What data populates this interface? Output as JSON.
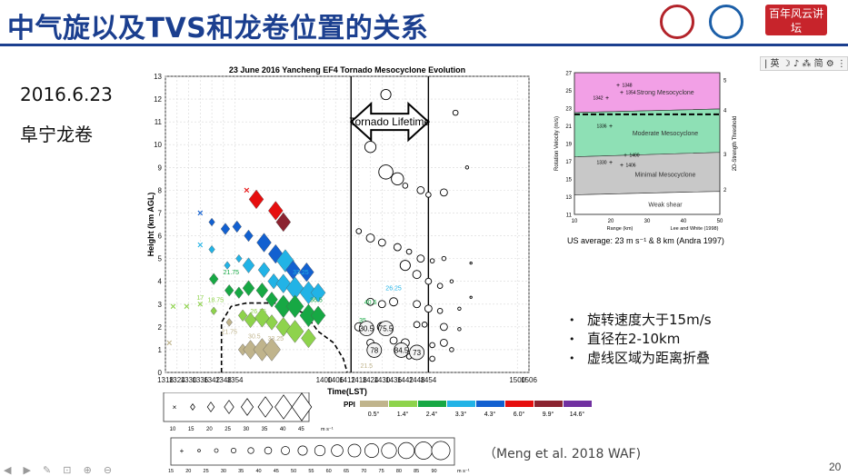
{
  "slide": {
    "title": "中气旋以及TVS和龙卷位置的关系",
    "date": "2016.6.23",
    "place": "阜宁龙卷",
    "page": "20",
    "citation": "（Meng et al. 2018 WAF)",
    "toolbar": "| 英 ☽ ♪ ⁂ 简 ⚙ ⋮",
    "badge": "百年风云讲坛",
    "bullets": [
      "旋转速度大于15m/s",
      "直径在2-10km",
      "虚线区域为距离折叠"
    ]
  },
  "chart_data": [
    {
      "type": "scatter",
      "title": "23 June 2016 Yancheng EF4 Tornado Mesocyclone Evolution",
      "xlabel": "Time(LST)",
      "ylabel": "Height (km AGL)",
      "xlim": [
        1318,
        1506
      ],
      "ylim": [
        0,
        13
      ],
      "x_ticks": [
        "1318",
        "1324",
        "1330",
        "1336",
        "1342",
        "1348",
        "1354",
        "1400",
        "1406",
        "1412",
        "1418",
        "1424",
        "1430",
        "1436",
        "1442",
        "1448",
        "1454",
        "1500",
        "1506"
      ],
      "y_ticks": [
        0,
        1,
        2,
        3,
        4,
        5,
        6,
        7,
        8,
        9,
        10,
        11,
        12,
        13
      ],
      "annotation": "Tornado Lifetime",
      "tornado_lifetime": [
        1414,
        1454
      ],
      "grid": true,
      "legend_ppi": {
        "label": "PPI",
        "entries": [
          {
            "angle": "0.5°",
            "color": "#c0b48c"
          },
          {
            "angle": "1.4°",
            "color": "#8ed34c"
          },
          {
            "angle": "2.4°",
            "color": "#17a844"
          },
          {
            "angle": "3.3°",
            "color": "#22b3e6"
          },
          {
            "angle": "4.3°",
            "color": "#1260d0"
          },
          {
            "angle": "6.0°",
            "color": "#e60e0e"
          },
          {
            "angle": "9.9°",
            "color": "#8b2330"
          },
          {
            "angle": "14.6°",
            "color": "#7030a0"
          }
        ]
      },
      "legend_diamond": {
        "values": [
          "10",
          "15",
          "20",
          "25",
          "30",
          "35",
          "40",
          "45"
        ],
        "unit": "m s⁻¹"
      },
      "legend_circle": {
        "values": [
          "15",
          "20",
          "25",
          "30",
          "35",
          "40",
          "45",
          "50",
          "55",
          "60",
          "65",
          "70",
          "75",
          "80",
          "85",
          "90"
        ],
        "unit": "m s⁻¹"
      },
      "mesocyclones": [
        {
          "x": 1320,
          "y": 1.3,
          "s": 0,
          "c": 0
        },
        {
          "x": 1322,
          "y": 2.9,
          "s": 0,
          "c": 1
        },
        {
          "x": 1329,
          "y": 2.9,
          "s": 0,
          "c": 1
        },
        {
          "x": 1336,
          "y": 3.0,
          "s": 0,
          "c": 1
        },
        {
          "x": 1336,
          "y": 5.6,
          "s": 0,
          "c": 3
        },
        {
          "x": 1336,
          "y": 7.0,
          "s": 0,
          "c": 4
        },
        {
          "x": 1342,
          "y": 5.4,
          "s": 1,
          "c": 3
        },
        {
          "x": 1342,
          "y": 6.6,
          "s": 1,
          "c": 4
        },
        {
          "x": 1343,
          "y": 4.1,
          "s": 2,
          "c": 2
        },
        {
          "x": 1343,
          "y": 2.7,
          "s": 1,
          "c": 1
        },
        {
          "x": 1349,
          "y": 6.3,
          "s": 2,
          "c": 4
        },
        {
          "x": 1350,
          "y": 4.7,
          "s": 1,
          "c": 3
        },
        {
          "x": 1351,
          "y": 3.6,
          "s": 2,
          "c": 2
        },
        {
          "x": 1351,
          "y": 2.2,
          "s": 1,
          "c": 0
        },
        {
          "x": 1355,
          "y": 6.4,
          "s": 2,
          "c": 4
        },
        {
          "x": 1356,
          "y": 5.0,
          "s": 1,
          "c": 3
        },
        {
          "x": 1356,
          "y": 3.5,
          "s": 2,
          "c": 2
        },
        {
          "x": 1358,
          "y": 2.5,
          "s": 2,
          "c": 1
        },
        {
          "x": 1358,
          "y": 1.0,
          "s": 2,
          "c": 0
        },
        {
          "x": 1360,
          "y": 8.0,
          "s": 0,
          "c": 5
        },
        {
          "x": 1361,
          "y": 6.0,
          "s": 2,
          "c": 4
        },
        {
          "x": 1361,
          "y": 4.7,
          "s": 3,
          "c": 3
        },
        {
          "x": 1361,
          "y": 3.7,
          "s": 3,
          "c": 2
        },
        {
          "x": 1362,
          "y": 2.3,
          "s": 3,
          "c": 1
        },
        {
          "x": 1362,
          "y": 1.0,
          "s": 4,
          "c": 0
        },
        {
          "x": 1365,
          "y": 7.6,
          "s": 4,
          "c": 5
        },
        {
          "x": 1369,
          "y": 5.7,
          "s": 4,
          "c": 4
        },
        {
          "x": 1369,
          "y": 4.5,
          "s": 3,
          "c": 3
        },
        {
          "x": 1368,
          "y": 3.6,
          "s": 3,
          "c": 2
        },
        {
          "x": 1368,
          "y": 2.4,
          "s": 4,
          "c": 1
        },
        {
          "x": 1368,
          "y": 1.0,
          "s": 5,
          "c": 0
        },
        {
          "x": 1375,
          "y": 7.1,
          "s": 4,
          "c": 5
        },
        {
          "x": 1375,
          "y": 5.2,
          "s": 4,
          "c": 4
        },
        {
          "x": 1374,
          "y": 4.0,
          "s": 3,
          "c": 3
        },
        {
          "x": 1373,
          "y": 3.2,
          "s": 3,
          "c": 2
        },
        {
          "x": 1373,
          "y": 2.2,
          "s": 3,
          "c": 1
        },
        {
          "x": 1373,
          "y": 1.0,
          "s": 5,
          "c": 0
        },
        {
          "x": 1379,
          "y": 6.6,
          "s": 4,
          "c": 6
        },
        {
          "x": 1380,
          "y": 4.9,
          "s": 5,
          "c": 3
        },
        {
          "x": 1379,
          "y": 3.9,
          "s": 4,
          "c": 3
        },
        {
          "x": 1379,
          "y": 2.9,
          "s": 5,
          "c": 2
        },
        {
          "x": 1379,
          "y": 2.0,
          "s": 4,
          "c": 1
        },
        {
          "x": 1384,
          "y": 4.5,
          "s": 4,
          "c": 4
        },
        {
          "x": 1385,
          "y": 3.7,
          "s": 5,
          "c": 3
        },
        {
          "x": 1385,
          "y": 2.9,
          "s": 5,
          "c": 2
        },
        {
          "x": 1385,
          "y": 1.8,
          "s": 5,
          "c": 1
        },
        {
          "x": 1391,
          "y": 4.4,
          "s": 4,
          "c": 4
        },
        {
          "x": 1392,
          "y": 3.5,
          "s": 5,
          "c": 3
        },
        {
          "x": 1392,
          "y": 2.5,
          "s": 5,
          "c": 2
        },
        {
          "x": 1392,
          "y": 1.5,
          "s": 4,
          "c": 1
        },
        {
          "x": 1397,
          "y": 3.5,
          "s": 4,
          "c": 3
        },
        {
          "x": 1397,
          "y": 2.5,
          "s": 4,
          "c": 2
        }
      ],
      "tvs": [
        {
          "x": 1424,
          "y": 9.9,
          "v": 60
        },
        {
          "x": 1432,
          "y": 12.2,
          "v": 55
        },
        {
          "x": 1432,
          "y": 8.8,
          "v": 75
        },
        {
          "x": 1438,
          "y": 8.5,
          "v": 65
        },
        {
          "x": 1442,
          "y": 8.2,
          "v": 30
        },
        {
          "x": 1450,
          "y": 8.0,
          "v": 40
        },
        {
          "x": 1454,
          "y": 7.8,
          "v": 30
        },
        {
          "x": 1462,
          "y": 7.9,
          "v": 40
        },
        {
          "x": 1418,
          "y": 6.2,
          "v": 30
        },
        {
          "x": 1424,
          "y": 5.9,
          "v": 45
        },
        {
          "x": 1430,
          "y": 5.7,
          "v": 40
        },
        {
          "x": 1438,
          "y": 5.5,
          "v": 40
        },
        {
          "x": 1444,
          "y": 5.3,
          "v": 30
        },
        {
          "x": 1450,
          "y": 5.0,
          "v": 40
        },
        {
          "x": 1456,
          "y": 4.9,
          "v": 25
        },
        {
          "x": 1462,
          "y": 5.0,
          "v": 25
        },
        {
          "x": 1442,
          "y": 4.7,
          "v": 55
        },
        {
          "x": 1448,
          "y": 4.3,
          "v": 45
        },
        {
          "x": 1454,
          "y": 4.0,
          "v": 35
        },
        {
          "x": 1460,
          "y": 3.8,
          "v": 30
        },
        {
          "x": 1424,
          "y": 3.1,
          "v": 40
        },
        {
          "x": 1430,
          "y": 3.0,
          "v": 40
        },
        {
          "x": 1436,
          "y": 3.1,
          "v": 45
        },
        {
          "x": 1448,
          "y": 3.0,
          "v": 40
        },
        {
          "x": 1454,
          "y": 2.8,
          "v": 40
        },
        {
          "x": 1460,
          "y": 2.7,
          "v": 30
        },
        {
          "x": 1418,
          "y": 2.0,
          "v": 45
        },
        {
          "x": 1430,
          "y": 2.0,
          "v": 50
        },
        {
          "x": 1448,
          "y": 2.1,
          "v": 35
        },
        {
          "x": 1452,
          "y": 2.1,
          "v": 30
        },
        {
          "x": 1462,
          "y": 2.0,
          "v": 40
        },
        {
          "x": 1424,
          "y": 1.3,
          "v": 40
        },
        {
          "x": 1436,
          "y": 1.4,
          "v": 40
        },
        {
          "x": 1442,
          "y": 1.3,
          "v": 45
        },
        {
          "x": 1456,
          "y": 1.2,
          "v": 30
        },
        {
          "x": 1462,
          "y": 1.3,
          "v": 40
        },
        {
          "x": 1444,
          "y": 0.7,
          "v": 30
        },
        {
          "x": 1456,
          "y": 0.6,
          "v": 30
        },
        {
          "x": 1466,
          "y": 1.0,
          "v": 25
        },
        {
          "x": 1470,
          "y": 1.9,
          "v": 20
        },
        {
          "x": 1470,
          "y": 2.8,
          "v": 20
        },
        {
          "x": 1466,
          "y": 4.0,
          "v": 20
        },
        {
          "x": 1476,
          "y": 3.3,
          "v": 15
        },
        {
          "x": 1476,
          "y": 4.8,
          "v": 15
        },
        {
          "x": 1474,
          "y": 9.0,
          "v": 20
        },
        {
          "x": 1468,
          "y": 11.4,
          "v": 30
        }
      ],
      "labels": [
        {
          "x": 1352,
          "y": 4.3,
          "t": "21.75",
          "c": 2
        },
        {
          "x": 1344,
          "y": 3.1,
          "t": "18.75",
          "c": 1
        },
        {
          "x": 1336,
          "y": 3.2,
          "t": "17",
          "c": 1
        },
        {
          "x": 1351,
          "y": 1.7,
          "t": "21.75",
          "c": 0
        },
        {
          "x": 1366,
          "y": 2.6,
          "t": "26.25",
          "c": 1
        },
        {
          "x": 1364,
          "y": 1.5,
          "t": "30.5",
          "c": 0
        },
        {
          "x": 1375,
          "y": 1.4,
          "t": "33.25",
          "c": 0
        },
        {
          "x": 1388,
          "y": 4.3,
          "t": "33.25",
          "c": 3
        },
        {
          "x": 1396,
          "y": 3.1,
          "t": "36.5",
          "c": 2
        },
        {
          "x": 1436,
          "y": 3.6,
          "t": "26.25",
          "c": 3
        },
        {
          "x": 1420,
          "y": 2.2,
          "t": "35",
          "c": 2
        },
        {
          "x": 1422,
          "y": 0.2,
          "t": "21.5",
          "c": 0
        },
        {
          "x": 1424,
          "y": 3.0,
          "t": "40.5",
          "c": 2
        }
      ],
      "boxed_values": [
        {
          "x": 1422,
          "y": 1.85,
          "t": "30.5"
        },
        {
          "x": 1432,
          "y": 1.85,
          "t": "75.5"
        },
        {
          "x": 1426,
          "y": 0.9,
          "t": "78"
        },
        {
          "x": 1440,
          "y": 0.9,
          "t": "84.5"
        },
        {
          "x": 1448,
          "y": 0.8,
          "t": "73"
        }
      ]
    },
    {
      "type": "area",
      "title": "",
      "xlabel": "Range (km)",
      "ylabel": "Rotation Velocity (m/s)",
      "y2label": "2D-Strength Threshold",
      "xlim": [
        10,
        50
      ],
      "ylim": [
        11,
        27
      ],
      "x_ticks": [
        10,
        20,
        30,
        40,
        50
      ],
      "y_ticks": [
        11,
        13,
        15,
        17,
        19,
        21,
        23,
        25,
        27
      ],
      "y2_ticks": [
        2,
        3,
        4,
        5
      ],
      "source_note": "Lee and White (1998)",
      "caption": "US average: 23 m s⁻¹ & 8 km (Andra 1997)",
      "dashed_line_y": 22.3,
      "bands": [
        {
          "name": "Strong Mesocyclone",
          "color": "#f2a0e6",
          "top": [
            27,
            27
          ],
          "bottom": [
            22.5,
            22.9
          ]
        },
        {
          "name": "Moderate Mesocyclone",
          "color": "#8ee0b5",
          "top": [
            22.5,
            22.9
          ],
          "bottom": [
            17.5,
            18.0
          ]
        },
        {
          "name": "Minimal Mesocyclone",
          "color": "#c8c8c8",
          "top": [
            17.5,
            18.0
          ],
          "bottom": [
            13.2,
            13.6
          ]
        },
        {
          "name": "Weak shear",
          "color": "#ffffff",
          "top": [
            13.2,
            13.6
          ],
          "bottom": [
            11,
            11
          ]
        }
      ],
      "points": [
        {
          "x": 22,
          "y": 25.6,
          "label": "1348"
        },
        {
          "x": 23,
          "y": 24.8,
          "label": "1354"
        },
        {
          "x": 19,
          "y": 24.2,
          "label": "1342"
        },
        {
          "x": 20,
          "y": 21.0,
          "label": "1336"
        },
        {
          "x": 24,
          "y": 17.7,
          "label": "1400"
        },
        {
          "x": 23,
          "y": 16.6,
          "label": "1406"
        },
        {
          "x": 20,
          "y": 16.9,
          "label": "1330"
        }
      ]
    }
  ]
}
